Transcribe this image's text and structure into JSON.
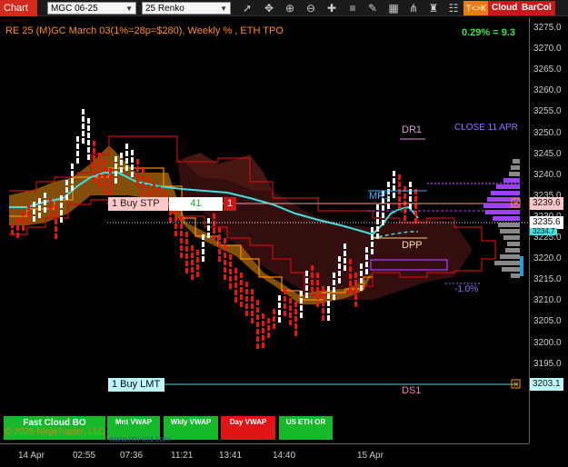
{
  "toolbar": {
    "tab": "Chart",
    "instrument": "MGC 06-25",
    "bar_type": "25 Renko",
    "icons": [
      "pointer-icon",
      "crosshair-icon",
      "zoom-in-icon",
      "zoom-out-icon",
      "plus-icon",
      "lines-icon",
      "drawing-icon",
      "grid-icon",
      "indicator-icon",
      "strategy-icon",
      "properties-icon"
    ],
    "tk_label": "T<>K",
    "cloud_label": "Cloud",
    "barcol_label": "BarCol"
  },
  "header": {
    "info": "RE 25 (M)GC March 03(1%=28p=$280), Weekly % , ETH TPO",
    "percent": "0.29% = 9.3"
  },
  "price_axis": {
    "labels": [
      "3275.0",
      "3270.0",
      "3265.0",
      "3260.0",
      "3255.0",
      "3250.0",
      "3245.0",
      "3240.0",
      "3235.0",
      "3230.0",
      "3225.0",
      "3220.0",
      "3215.0",
      "3210.0",
      "3205.0",
      "3200.0",
      "3195.0"
    ],
    "markers": {
      "stop": "3239.6",
      "current": "3235.6",
      "mid": "3234.7",
      "limit": "3203.1"
    }
  },
  "time_axis": {
    "labels": [
      "14 Apr",
      "02:55",
      "07:36",
      "11:21",
      "13:41",
      "14:40",
      "15 Apr"
    ]
  },
  "levels": {
    "dr1": "DR1",
    "close": "CLOSE 11 APR",
    "mr1": "MR1",
    "dpp": "DPP",
    "pct_label": "-1.0%",
    "ds1": "DS1"
  },
  "orders": {
    "stop_label": "1 Buy STP",
    "stop_qty": "41",
    "stop_count": "1",
    "limit_label": "1 Buy LMT"
  },
  "buttons": {
    "fast_cloud": "Fast Cloud BO",
    "mnt_vwap": "Mnt VWAP",
    "wkly_vwap": "Wkly VWAP",
    "day_vwap": "Day VWAP",
    "us_eth": "US ETH OR"
  },
  "footer": {
    "copyright": "© 2025 NinjaTrader, LLC",
    "url": "www.nin-ind.com"
  },
  "colors": {
    "bull": "#ffffff",
    "bear": "#e8170e",
    "vwap": "#3ee0e0",
    "cloud_bull": "#b06a10",
    "cloud_bear": "#4a1510",
    "accent": "#c81a1a"
  }
}
